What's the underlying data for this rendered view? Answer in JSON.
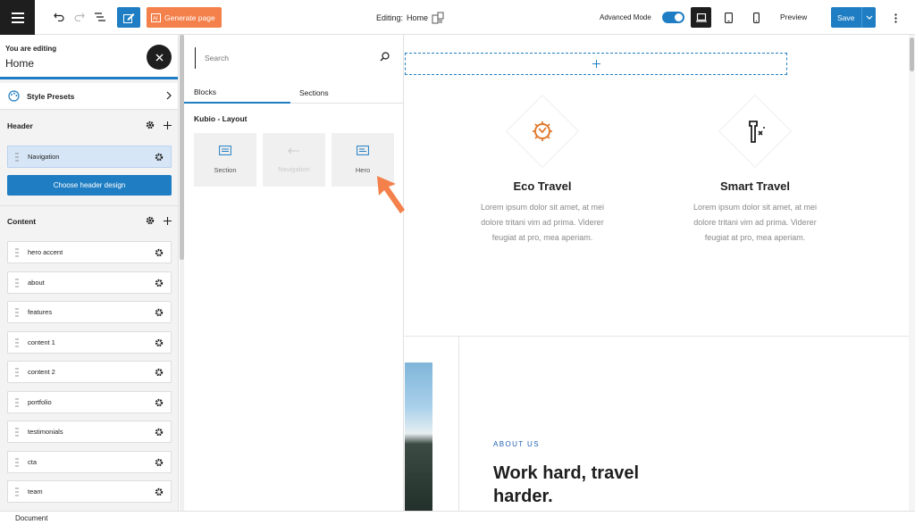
{
  "topbar": {
    "generate_label": "Generate page",
    "editing_prefix": "Editing:",
    "editing_page": "Home",
    "advanced_mode_label": "Advanced Mode",
    "advanced_mode_on": true,
    "preview_label": "Preview",
    "save_label": "Save"
  },
  "sidebar": {
    "editing_caption": "You are editing",
    "editing_page": "Home",
    "style_presets_label": "Style Presets",
    "header_section_title": "Header",
    "navigation_label": "Navigation",
    "choose_header_label": "Choose header design",
    "content_section_title": "Content",
    "content_items": [
      {
        "label": "hero accent"
      },
      {
        "label": "about"
      },
      {
        "label": "features"
      },
      {
        "label": "content 1"
      },
      {
        "label": "content 2"
      },
      {
        "label": "portfolio"
      },
      {
        "label": "testimonials"
      },
      {
        "label": "cta"
      },
      {
        "label": "team"
      }
    ]
  },
  "inserter": {
    "search_placeholder": "Search",
    "tabs": [
      {
        "label": "Blocks"
      },
      {
        "label": "Sections"
      }
    ],
    "category_title": "Kubio - Layout",
    "blocks": [
      {
        "label": "Section",
        "icon": "section-icon",
        "enabled": true
      },
      {
        "label": "Navigation",
        "icon": "navigation-icon",
        "enabled": false
      },
      {
        "label": "Hero",
        "icon": "hero-icon",
        "enabled": true
      }
    ]
  },
  "canvas": {
    "features": [
      {
        "title": "Eco Travel",
        "text": "Lorem ipsum dolor sit amet, at mei dolore tritani vim ad prima. Viderer feugiat at pro, mea aperiam.",
        "icon": "eco-icon"
      },
      {
        "title": "Smart Travel",
        "text": "Lorem ipsum dolor sit amet, at mei dolore tritani vim ad prima. Viderer feugiat at pro, mea aperiam.",
        "icon": "smart-icon"
      }
    ],
    "about_label": "ABOUT US",
    "about_title": "Work hard, travel harder."
  },
  "statusbar": {
    "label": "Document"
  },
  "colors": {
    "accent": "#1f7ec3",
    "generate": "#f4804b",
    "feature_icon_orange": "#e07a2e",
    "about_label": "#1f5fb3"
  }
}
